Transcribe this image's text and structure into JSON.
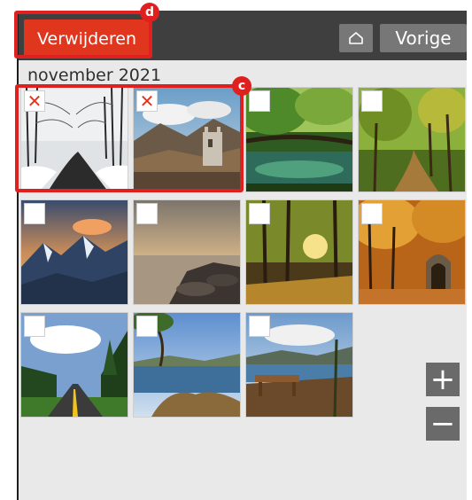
{
  "toolbar": {
    "delete_label": "Verwijderen",
    "home_icon": "home-icon",
    "previous_label": "Vorige"
  },
  "gallery": {
    "month_label": "november 2021",
    "photos": [
      {
        "name": "snowy-forest-road",
        "selected": true
      },
      {
        "name": "mountain-ruins",
        "selected": true
      },
      {
        "name": "green-lake-tree",
        "selected": false
      },
      {
        "name": "forest-path",
        "selected": false
      },
      {
        "name": "snowy-mountains-sunset",
        "selected": false
      },
      {
        "name": "rocky-shore-sunset",
        "selected": false
      },
      {
        "name": "sunlit-forest",
        "selected": false
      },
      {
        "name": "autumn-stone-arch",
        "selected": false
      },
      {
        "name": "road-through-pines",
        "selected": false
      },
      {
        "name": "tree-root-lake",
        "selected": false
      },
      {
        "name": "bench-overlook-lake",
        "selected": false
      }
    ]
  },
  "zoom": {
    "in_icon": "plus-icon",
    "out_icon": "minus-icon"
  },
  "annotations": {
    "badge_c": "c",
    "badge_d": "d"
  },
  "colors": {
    "accent": "#e0361e",
    "toolbar_bg": "#3f3f3f",
    "button_gray": "#777777",
    "highlight": "#e01f1f"
  }
}
